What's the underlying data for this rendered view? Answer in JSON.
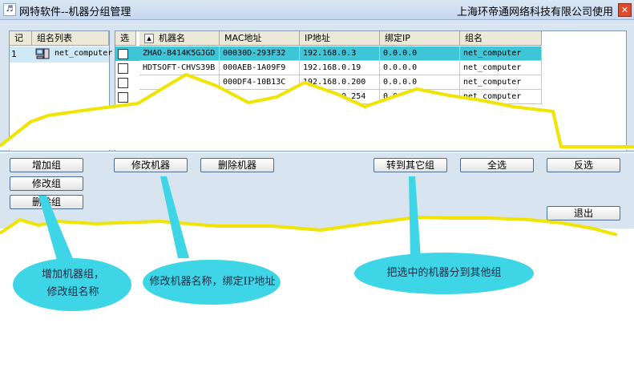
{
  "window": {
    "title": "网特软件--机器分组管理",
    "company": "上海环帝通网络科技有限公司使用",
    "close_glyph": "✕",
    "app_icon_glyph": "♬"
  },
  "group_list": {
    "headers": [
      "记",
      "组名列表"
    ],
    "rows": [
      {
        "num": "1",
        "name": "net_computer"
      }
    ]
  },
  "machine_table": {
    "headers": [
      "选",
      "机器名",
      "MAC地址",
      "IP地址",
      "绑定IP",
      "组名"
    ],
    "rows": [
      {
        "name": "ZHAO-B414K5GJGD",
        "mac": "00030D-293F32",
        "ip": "192.168.0.3",
        "bind": "0.0.0.0",
        "group": "net_computer",
        "selected": true
      },
      {
        "name": "HDTSOFT-CHVS39B",
        "mac": "000AEB-1A09F9",
        "ip": "192.168.0.19",
        "bind": "0.0.0.0",
        "group": "net_computer",
        "selected": false
      },
      {
        "name": "",
        "mac": "000DF4-10B13C",
        "ip": "192.168.0.200",
        "bind": "0.0.0.0",
        "group": "net_computer",
        "selected": false
      },
      {
        "name": "",
        "mac": "",
        "ip": "192.168.0.254",
        "bind": "0.0.0.0",
        "group": "net_computer",
        "selected": false
      }
    ]
  },
  "buttons": {
    "add_group": "增加组",
    "modify_group": "修改组",
    "delete_group": "删除组",
    "modify_machine": "修改机器",
    "delete_machine": "删除机器",
    "move_to_group": "转到其它组",
    "select_all": "全选",
    "invert": "反选",
    "exit": "退出"
  },
  "callouts": {
    "group_callout": "增加机器组，\n修改组名称",
    "machine_callout": "修改机器名称，绑定IP地址",
    "move_callout": "把选中的机器分到其他组"
  },
  "colors": {
    "selected_row": "#3ec5d8",
    "callout_fill": "#3ed6e6",
    "tear_line": "#f0e400"
  }
}
